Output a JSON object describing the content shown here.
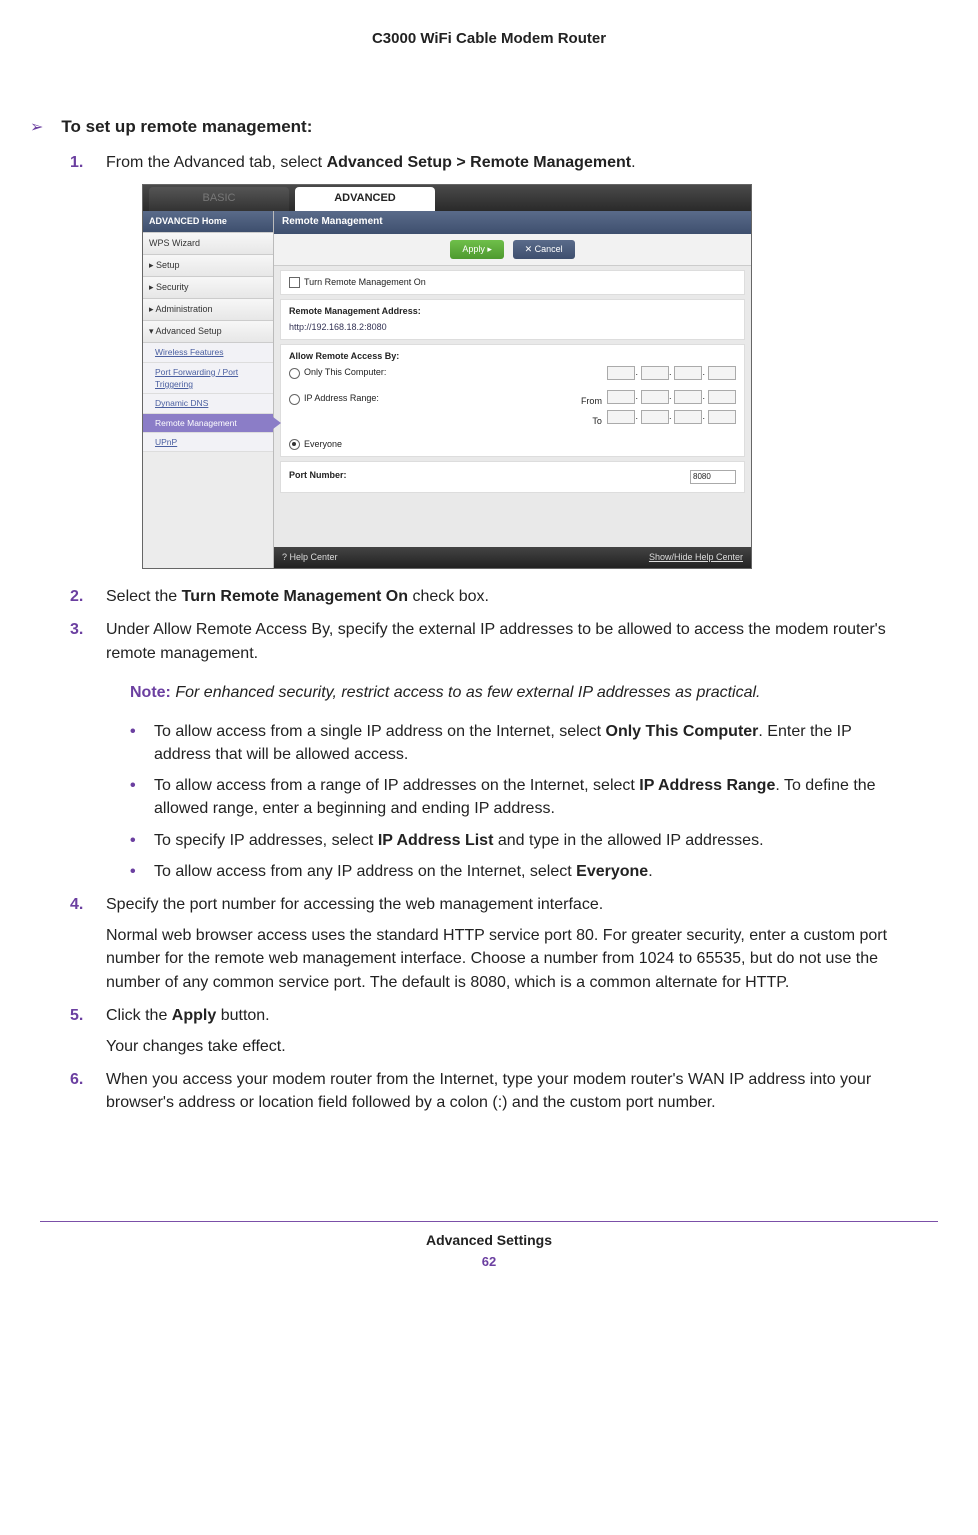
{
  "doc_header": "C3000 WiFi Cable Modem Router",
  "proc_title": "To set up remote management:",
  "steps": {
    "s1": {
      "num": "1.",
      "pre": "From the Advanced tab, select ",
      "bold": "Advanced Setup > Remote Management",
      "post": "."
    },
    "s2": {
      "num": "2.",
      "pre": "Select the ",
      "bold": "Turn Remote Management On",
      "post": " check box."
    },
    "s3": {
      "num": "3.",
      "text": "Under Allow Remote Access By, specify the external IP addresses to be allowed to access the modem router's remote management."
    },
    "s4": {
      "num": "4.",
      "text": "Specify the port number for accessing the web management interface.",
      "para": "Normal web browser access uses the standard HTTP service port 80. For greater security, enter a custom port number for the remote web management interface. Choose a number from 1024 to 65535, but do not use the number of any common service port. The default is 8080, which is a common alternate for HTTP."
    },
    "s5": {
      "num": "5.",
      "pre": "Click the ",
      "bold": "Apply",
      "post": " button.",
      "para": "Your changes take effect."
    },
    "s6": {
      "num": "6.",
      "text": "When you access your modem router from the Internet, type your modem router's WAN IP address into your browser's address or location field followed by a colon (:) and the custom port number."
    }
  },
  "note": {
    "label": "Note:",
    "text": "For enhanced security, restrict access to as few external IP addresses as practical."
  },
  "bullets": {
    "b1": {
      "pre": "To allow access from a single IP address on the Internet, select ",
      "bold": "Only This Computer",
      "post": ". Enter the IP address that will be allowed access."
    },
    "b2": {
      "pre": "To allow access from a range of IP addresses on the Internet, select ",
      "bold": "IP Address Range",
      "post": ". To define the allowed range, enter a beginning and ending IP address."
    },
    "b3": {
      "pre": "To specify IP addresses, select ",
      "bold": "IP Address List",
      "post": " and type in the allowed IP addresses."
    },
    "b4": {
      "pre": "To allow access from any IP address on the Internet, select ",
      "bold": "Everyone",
      "post": "."
    }
  },
  "ui": {
    "tab_basic": "BASIC",
    "tab_advanced": "ADVANCED",
    "side": {
      "home": "ADVANCED Home",
      "wps": "WPS Wizard",
      "setup": "▸ Setup",
      "security": "▸ Security",
      "admin": "▸ Administration",
      "advsetup": "▾ Advanced Setup",
      "wireless": "Wireless Features",
      "portfwd": "Port Forwarding / Port Triggering",
      "ddns": "Dynamic DNS",
      "remote": "Remote Management",
      "upnp": "UPnP"
    },
    "panel_title": "Remote Management",
    "apply": "Apply ▸",
    "cancel": "✕ Cancel",
    "turn_on": "Turn Remote Management On",
    "addr_label": "Remote Management Address:",
    "addr_value": "http://192.168.18.2:8080",
    "allow_label": "Allow Remote Access By:",
    "only_this": "Only This Computer:",
    "ip_range": "IP Address Range:",
    "from": "From",
    "to": "To",
    "everyone": "Everyone",
    "port_label": "Port Number:",
    "port_value": "8080",
    "help": "? Help Center",
    "showhide": "Show/Hide Help Center"
  },
  "footer_section": "Advanced Settings",
  "page_number": "62"
}
